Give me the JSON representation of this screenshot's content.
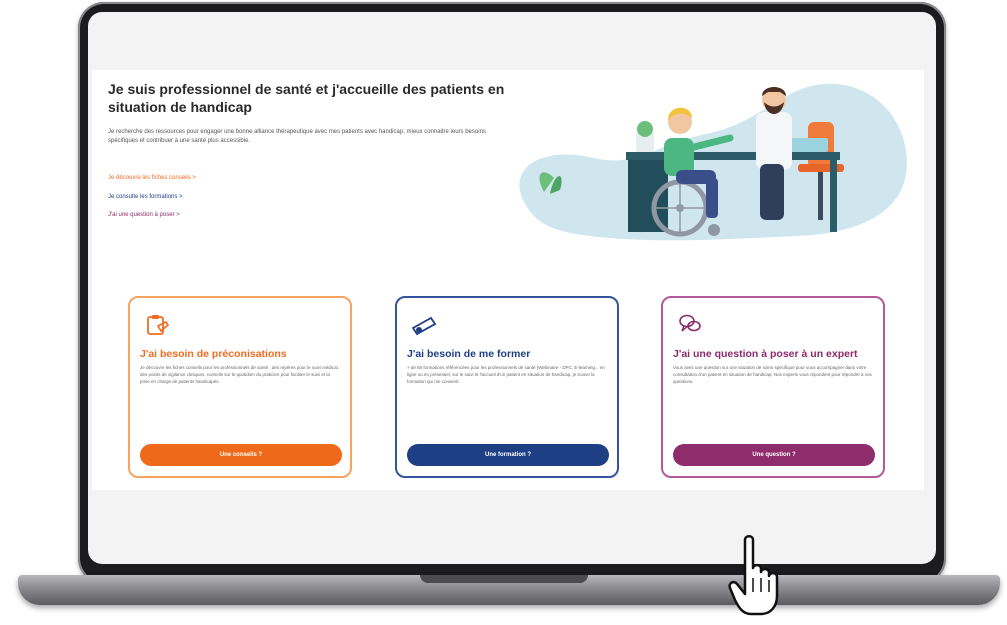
{
  "hero": {
    "title": "Je suis professionnel de santé et j'accueille des patients en situation de handicap",
    "description": "Je recherche des ressources pour engager une bonne alliance thérapeutique avec mes patients avec handicap, mieux connaitre leurs besoins spécifiques et contribuer à une santé plus accessible.",
    "links": [
      "Je découvre les fiches conseils >",
      "Je consulte les formations >",
      "J'ai une question à poser >"
    ]
  },
  "cards": [
    {
      "title": "J'ai besoin de préconisations",
      "text": "Je découvre les fiches conseils pour les professionnels de santé : des repères pour le suivi médical, des points de vigilance cliniques, conseils sur le quotidien du praticien pour faciliter le suivi et la prise en charge de patients handicapés.",
      "button": "Une conseils ?",
      "color": "#ee6a1a"
    },
    {
      "title": "J'ai besoin de me former",
      "text": "+ de 60 formations référencées pour les professionnels de santé (Webinaire - DPC, E-learning... en ligne ou en présentiel, sur le suivi et l'accueil d'un patient en situation de handicap, je trouve la formation qui me convient.",
      "button": "Une formation ?",
      "color": "#1f3f85"
    },
    {
      "title": "J'ai une question à poser à un expert",
      "text": "Vous avez une question sur une situation de soins spécifique pour vous accompagner dans votre consultation d'un patient en situation de handicap. Nos experts vous répondent pour répondre à vos questions.",
      "button": "Une question ?",
      "color": "#8e2c6c"
    }
  ],
  "icons": {
    "card_1": "clipboard-hand-icon",
    "card_2": "diploma-icon",
    "card_3": "speech-bubbles-icon",
    "cursor": "hand-pointer-icon"
  }
}
